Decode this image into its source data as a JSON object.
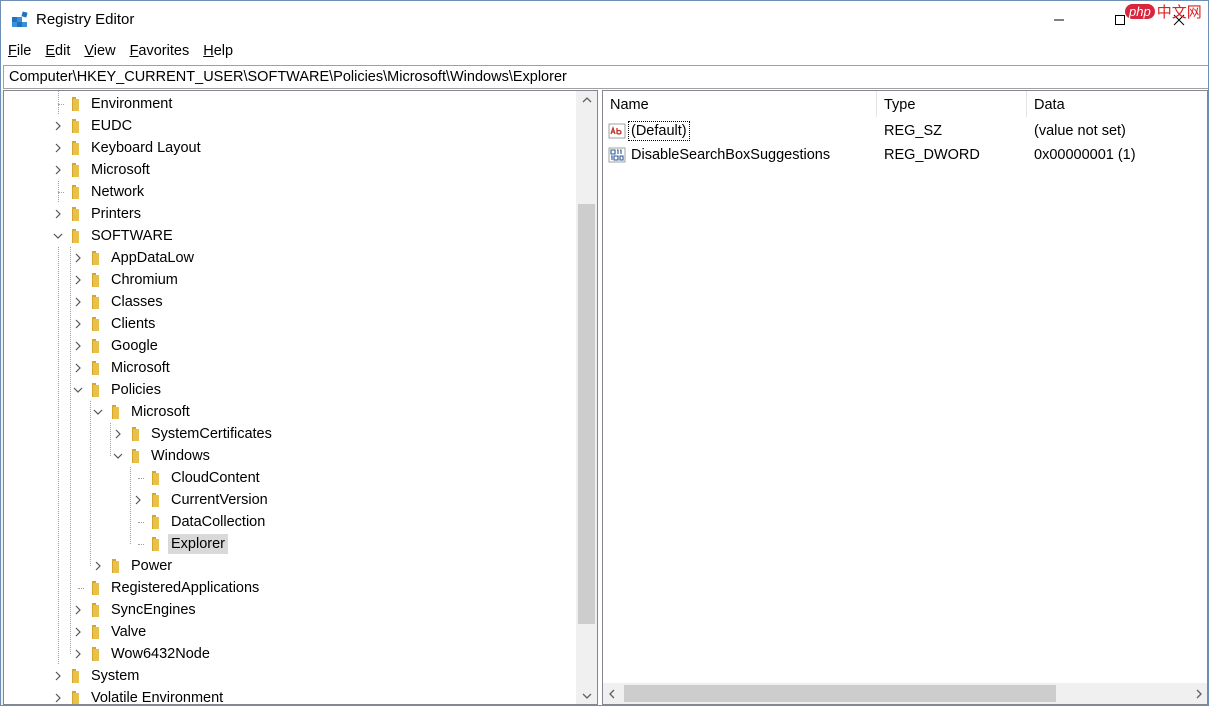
{
  "window": {
    "title": "Registry Editor",
    "watermark_badge": "php",
    "watermark_text": "中文网"
  },
  "menu": [
    {
      "label": "File",
      "accel": "F",
      "rest": "ile"
    },
    {
      "label": "Edit",
      "accel": "E",
      "rest": "dit"
    },
    {
      "label": "View",
      "accel": "V",
      "rest": "iew"
    },
    {
      "label": "Favorites",
      "accel": "F",
      "rest": "avorites"
    },
    {
      "label": "Help",
      "accel": "H",
      "rest": "elp"
    }
  ],
  "address": "Computer\\HKEY_CURRENT_USER\\SOFTWARE\\Policies\\Microsoft\\Windows\\Explorer",
  "tree": [
    {
      "label": "Environment",
      "level": 0,
      "expander": "none"
    },
    {
      "label": "EUDC",
      "level": 0,
      "expander": "collapsed"
    },
    {
      "label": "Keyboard Layout",
      "level": 0,
      "expander": "collapsed"
    },
    {
      "label": "Microsoft",
      "level": 0,
      "expander": "collapsed"
    },
    {
      "label": "Network",
      "level": 0,
      "expander": "none"
    },
    {
      "label": "Printers",
      "level": 0,
      "expander": "collapsed"
    },
    {
      "label": "SOFTWARE",
      "level": 0,
      "expander": "expanded"
    },
    {
      "label": "AppDataLow",
      "level": 1,
      "expander": "collapsed"
    },
    {
      "label": "Chromium",
      "level": 1,
      "expander": "collapsed"
    },
    {
      "label": "Classes",
      "level": 1,
      "expander": "collapsed"
    },
    {
      "label": "Clients",
      "level": 1,
      "expander": "collapsed"
    },
    {
      "label": "Google",
      "level": 1,
      "expander": "collapsed"
    },
    {
      "label": "Microsoft",
      "level": 1,
      "expander": "collapsed"
    },
    {
      "label": "Policies",
      "level": 1,
      "expander": "expanded"
    },
    {
      "label": "Microsoft",
      "level": 2,
      "expander": "expanded"
    },
    {
      "label": "SystemCertificates",
      "level": 3,
      "expander": "collapsed"
    },
    {
      "label": "Windows",
      "level": 3,
      "expander": "expanded"
    },
    {
      "label": "CloudContent",
      "level": 4,
      "expander": "none"
    },
    {
      "label": "CurrentVersion",
      "level": 4,
      "expander": "collapsed"
    },
    {
      "label": "DataCollection",
      "level": 4,
      "expander": "none"
    },
    {
      "label": "Explorer",
      "level": 4,
      "expander": "none",
      "selected": true
    },
    {
      "label": "Power",
      "level": 2,
      "expander": "collapsed"
    },
    {
      "label": "RegisteredApplications",
      "level": 1,
      "expander": "none"
    },
    {
      "label": "SyncEngines",
      "level": 1,
      "expander": "collapsed"
    },
    {
      "label": "Valve",
      "level": 1,
      "expander": "collapsed"
    },
    {
      "label": "Wow6432Node",
      "level": 1,
      "expander": "collapsed"
    },
    {
      "label": "System",
      "level": 0,
      "expander": "collapsed"
    },
    {
      "label": "Volatile Environment",
      "level": 0,
      "expander": "collapsed"
    }
  ],
  "values_header": {
    "name": "Name",
    "type": "Type",
    "data": "Data"
  },
  "values": [
    {
      "name": "(Default)",
      "type": "REG_SZ",
      "data": "(value not set)",
      "icon": "string-value-icon",
      "focused": true
    },
    {
      "name": "DisableSearchBoxSuggestions",
      "type": "REG_DWORD",
      "data": "0x00000001 (1)",
      "icon": "binary-value-icon",
      "focused": false
    }
  ],
  "colors": {
    "folder": "#e8c04a",
    "folder_dark": "#d4a72c",
    "selection": "#d9d9d9",
    "scrollbar_track": "#f0f0f0",
    "scrollbar_thumb": "#cdcdcd",
    "string_icon": "#c0392b",
    "binary_icon": "#2b5797"
  }
}
